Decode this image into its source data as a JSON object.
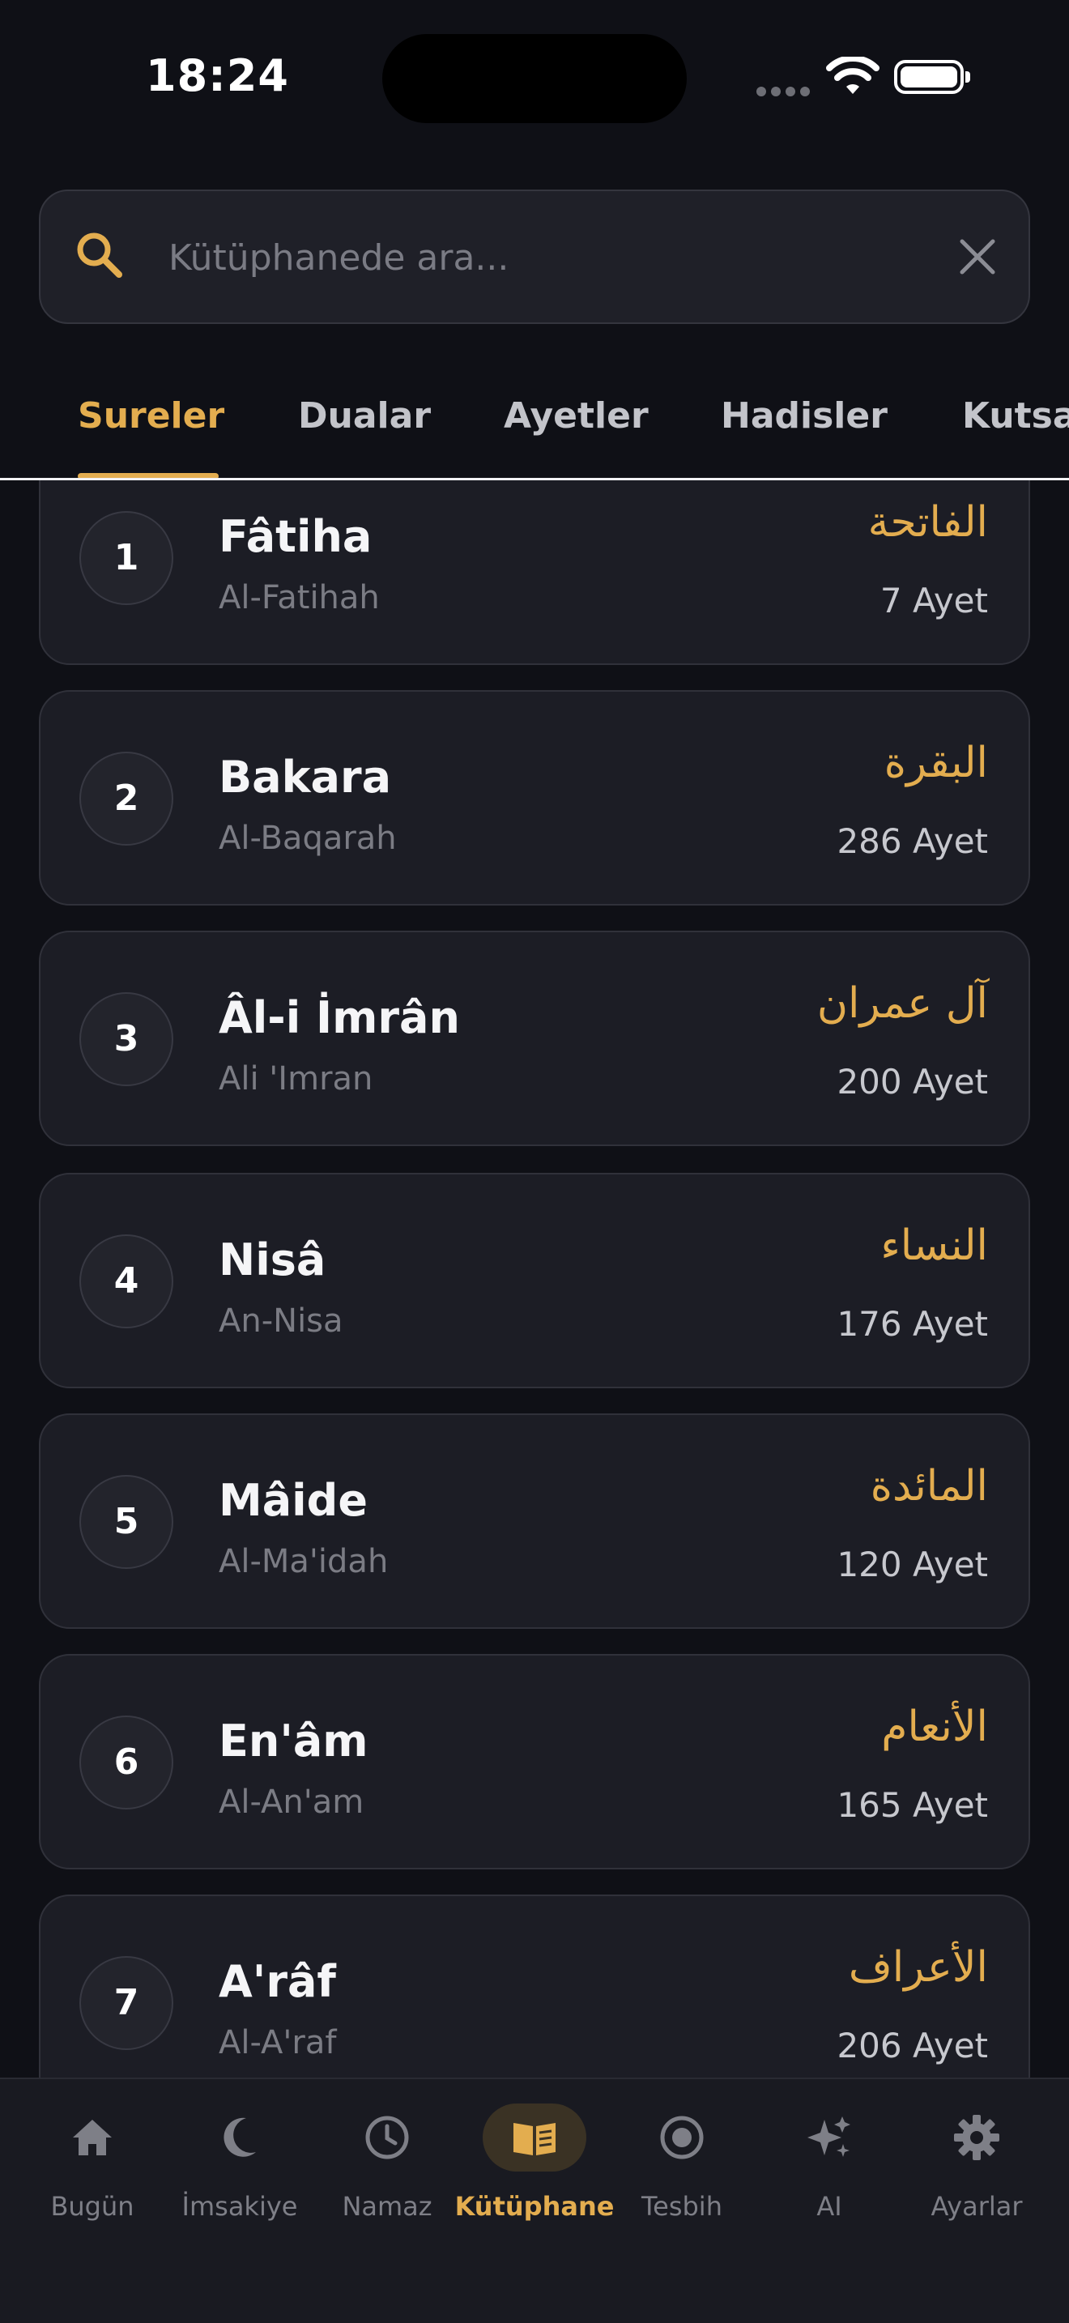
{
  "status": {
    "time": "18:24"
  },
  "search": {
    "placeholder": "Kütüphanede ara...",
    "value": ""
  },
  "tabs": [
    {
      "label": "Sureler",
      "active": true
    },
    {
      "label": "Dualar"
    },
    {
      "label": "Ayetler"
    },
    {
      "label": "Hadisler"
    },
    {
      "label": "Kutsal Geceler"
    }
  ],
  "surahs": [
    {
      "number": "1",
      "name": "Fâtiha",
      "latin": "Al-Fatihah",
      "arabic": "الفاتحة",
      "verses": "7 Ayet"
    },
    {
      "number": "2",
      "name": "Bakara",
      "latin": "Al-Baqarah",
      "arabic": "البقرة",
      "verses": "286 Ayet"
    },
    {
      "number": "3",
      "name": "Âl-i İmrân",
      "latin": "Ali 'Imran",
      "arabic": "آل عمران",
      "verses": "200 Ayet"
    },
    {
      "number": "4",
      "name": "Nisâ",
      "latin": "An-Nisa",
      "arabic": "النساء",
      "verses": "176 Ayet"
    },
    {
      "number": "5",
      "name": "Mâide",
      "latin": "Al-Ma'idah",
      "arabic": "المائدة",
      "verses": "120 Ayet"
    },
    {
      "number": "6",
      "name": "En'âm",
      "latin": "Al-An'am",
      "arabic": "الأنعام",
      "verses": "165 Ayet"
    },
    {
      "number": "7",
      "name": "A'râf",
      "latin": "Al-A'raf",
      "arabic": "الأعراف",
      "verses": "206 Ayet"
    }
  ],
  "nav": [
    {
      "label": "Bugün",
      "icon": "home-icon"
    },
    {
      "label": "İmsakiye",
      "icon": "moon-icon"
    },
    {
      "label": "Namaz",
      "icon": "clock-icon"
    },
    {
      "label": "Kütüphane",
      "icon": "book-icon",
      "active": true
    },
    {
      "label": "Tesbih",
      "icon": "tesbih-icon"
    },
    {
      "label": "AI",
      "icon": "sparkles-icon"
    },
    {
      "label": "Ayarlar",
      "icon": "gear-icon"
    }
  ],
  "colors": {
    "accent": "#e3ad4f",
    "background": "#0f1016",
    "card": "#1c1d25"
  }
}
